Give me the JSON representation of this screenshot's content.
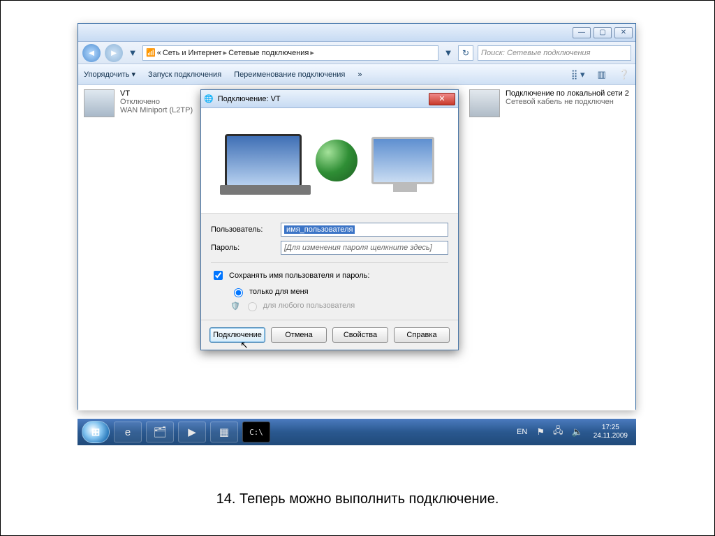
{
  "caption": "14. Теперь можно выполнить подключение.",
  "explorer": {
    "breadcrumb": {
      "root": "«",
      "seg1": "Сеть и Интернет",
      "seg2": "Сетевые подключения"
    },
    "search_placeholder": "Поиск: Сетевые подключения",
    "toolbar": {
      "organize": "Упорядочить ▾",
      "start": "Запуск подключения",
      "rename": "Переименование подключения",
      "more": "»"
    },
    "conn_left": {
      "name": "VT",
      "line1": "Отключено",
      "line2": "WAN Miniport (L2TP)"
    },
    "conn_right": {
      "name": "Подключение по локальной сети 2",
      "line1": "Сетевой кабель не подключен"
    }
  },
  "dialog": {
    "title": "Подключение: VT",
    "user_label": "Пользователь:",
    "user_value": "имя_пользователя",
    "pass_label": "Пароль:",
    "pass_placeholder": "[Для изменения пароля щелкните здесь]",
    "save_check": "Сохранять имя пользователя и пароль:",
    "radio_me": "только для меня",
    "radio_any": "для любого пользователя",
    "btn_connect": "Подключение",
    "btn_cancel": "Отмена",
    "btn_props": "Свойства",
    "btn_help": "Справка"
  },
  "taskbar": {
    "lang": "EN",
    "time": "17:25",
    "date": "24.11.2009"
  }
}
